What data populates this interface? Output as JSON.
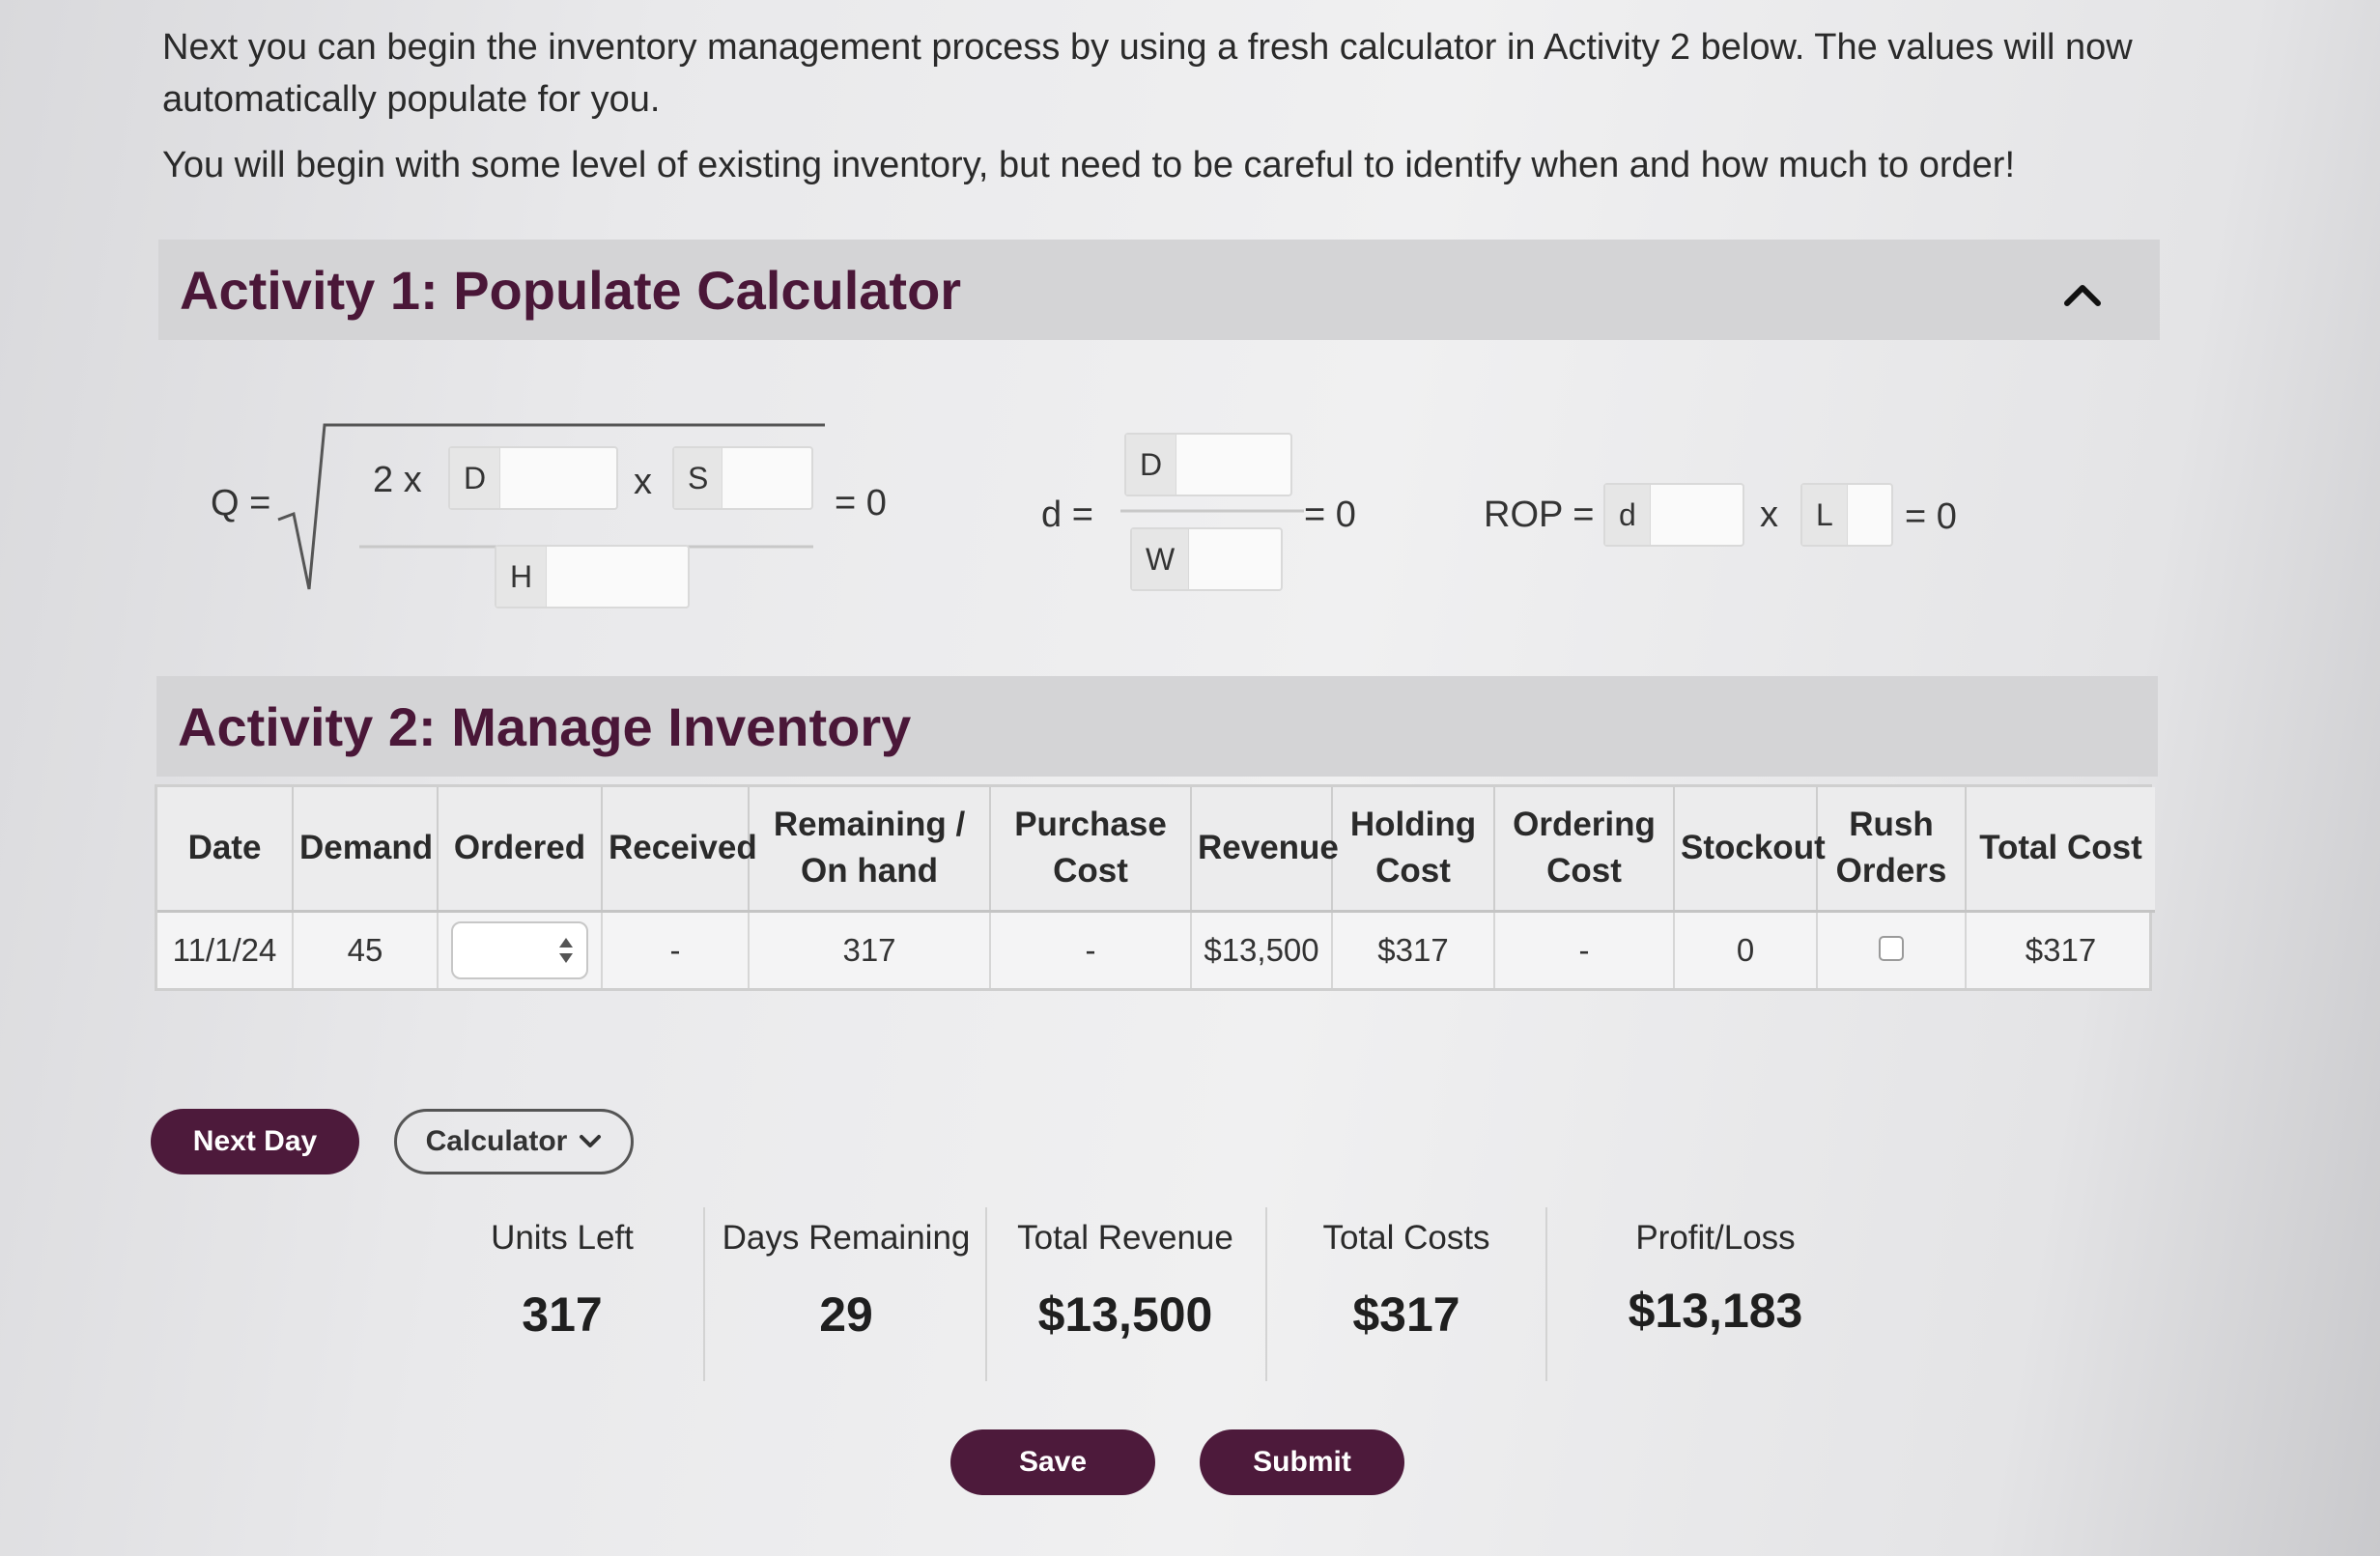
{
  "intro": {
    "p1": "Next you can begin the inventory management process by using a fresh calculator in Activity 2 below. The values will now automatically populate for you.",
    "p2": "You will begin with some level of existing inventory, but need to be careful to identify when and how much to order!"
  },
  "activity1": {
    "title": "Activity 1: Populate Calculator",
    "q": {
      "label": "Q =",
      "two_x": "2 x",
      "times": "x",
      "d_tag": "D",
      "s_tag": "S",
      "h_tag": "H",
      "result": "= 0"
    },
    "d": {
      "label": "d =",
      "d_tag": "D",
      "w_tag": "W",
      "result": "= 0"
    },
    "rop": {
      "label": "ROP =",
      "d_tag": "d",
      "times": "x",
      "l_tag": "L",
      "result": "= 0"
    }
  },
  "activity2": {
    "title": "Activity 2: Manage Inventory",
    "headers": {
      "date": "Date",
      "demand": "Demand",
      "ordered": "Ordered",
      "received": "Received",
      "remaining_1": "Remaining /",
      "remaining_2": "On hand",
      "purchase_1": "Purchase",
      "purchase_2": "Cost",
      "revenue": "Revenue",
      "holding_1": "Holding",
      "holding_2": "Cost",
      "ordering_1": "Ordering",
      "ordering_2": "Cost",
      "stockout": "Stockout",
      "rush_1": "Rush",
      "rush_2": "Orders",
      "total": "Total Cost"
    },
    "row": {
      "date": "11/1/24",
      "demand": "45",
      "received": "-",
      "remaining": "317",
      "purchase": "-",
      "revenue": "$13,500",
      "holding": "$317",
      "ordering": "-",
      "stockout": "0",
      "total": "$317"
    }
  },
  "buttons": {
    "next_day": "Next Day",
    "calculator": "Calculator",
    "save": "Save",
    "submit": "Submit"
  },
  "stats": {
    "units_left": {
      "label": "Units Left",
      "value": "317"
    },
    "days_remaining": {
      "label": "Days Remaining",
      "value": "29"
    },
    "total_revenue": {
      "label": "Total Revenue",
      "value": "$13,500"
    },
    "total_costs": {
      "label": "Total Costs",
      "value": "$317"
    },
    "profit_loss": {
      "label": "Profit/Loss",
      "value": "$13,183"
    }
  },
  "colors": {
    "accent": "#4d1a3b",
    "header_bg": "#d4d4d6"
  },
  "icons": {
    "collapse": "chevron-up-icon",
    "dropdown": "chevron-down-icon",
    "stepper": "up-down-arrows-icon"
  }
}
